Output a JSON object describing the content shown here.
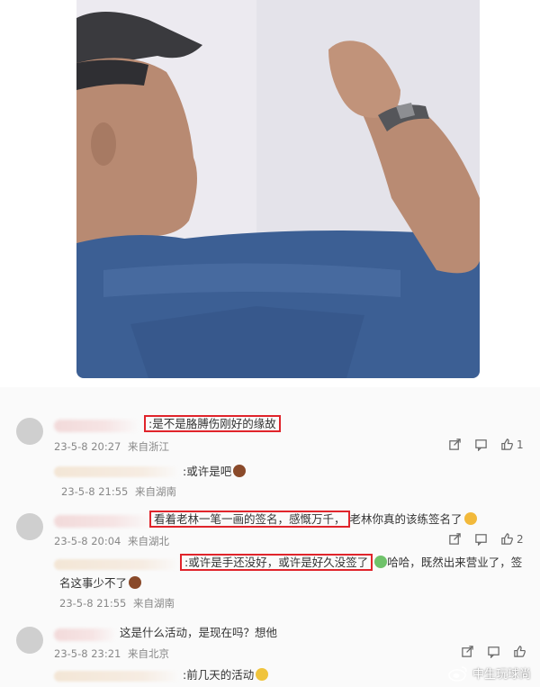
{
  "comments": [
    {
      "text": ":是不是胳膊伤刚好的缘故",
      "date": "23-5-8 20:27",
      "location": "来自浙江",
      "likes": "1",
      "emoji": ""
    },
    {
      "text": ":或许是吧",
      "date": "23-5-8 21:55",
      "location": "来自湖南",
      "emoji": "person-emoji"
    },
    {
      "text_highlight": "看着老林一笔一画的签名，感慨万千，",
      "text_rest": "老林你真的该练签名了",
      "date": "23-5-8 20:04",
      "location": "来自湖北",
      "likes": "2",
      "emoji": "face-emoji"
    },
    {
      "text_highlight": ":或许是手还没好，或许是好久没签了",
      "text_rest": "哈哈，既然出来营业了，签",
      "text_line2": "名这事少不了",
      "date": "23-5-8 21:55",
      "location": "来自湖南",
      "emoji": "person-emoji"
    },
    {
      "text": "这是什么活动，是现在吗？想他",
      "date": "23-5-8 23:21",
      "location": "来自北京",
      "emoji": ""
    },
    {
      "text": ":前几天的活动",
      "emoji": "crying-face-emoji"
    }
  ],
  "watermark": {
    "text": "中生玩球尚"
  },
  "colors": {
    "highlight_border": "#e0242b",
    "meta_text": "#888888"
  },
  "icons": [
    "share-icon",
    "comment-icon",
    "like-icon",
    "person-emoji",
    "face-emoji",
    "crying-face-emoji",
    "weibo-logo-icon"
  ]
}
